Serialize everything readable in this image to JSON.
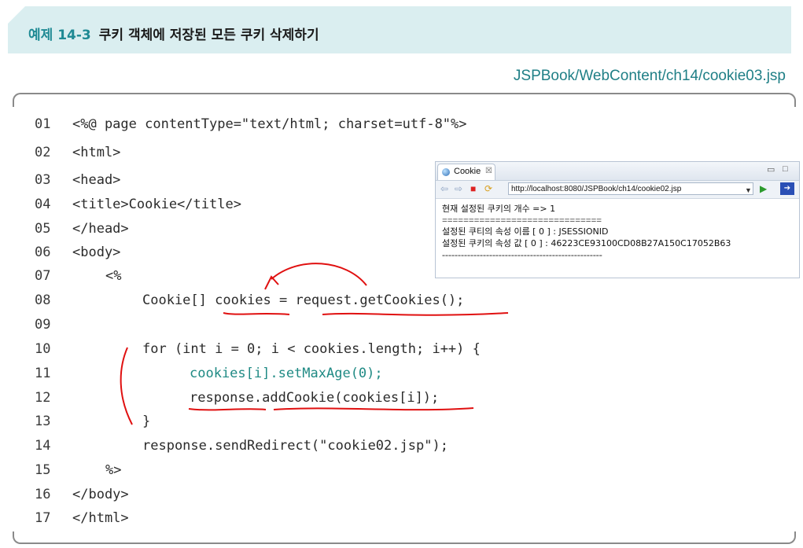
{
  "header": {
    "example_number": "예제 14-3",
    "example_title": "쿠키 객체에 저장된 모든 쿠키 삭제하기"
  },
  "file_path": "JSPBook/WebContent/ch14/cookie03.jsp",
  "code_lines": [
    {
      "num": "01",
      "text": "<%@ page contentType=\"text/html; charset=utf-8\"%>"
    },
    {
      "num": "02",
      "text": "<html>"
    },
    {
      "num": "03",
      "text": "<head>"
    },
    {
      "num": "04",
      "text": "<title>Cookie</title>"
    },
    {
      "num": "05",
      "text": "</head>"
    },
    {
      "num": "06",
      "text": "<body>"
    },
    {
      "num": "07",
      "text": "<%"
    },
    {
      "num": "08",
      "text": "Cookie[] cookies = request.getCookies();"
    },
    {
      "num": "09",
      "text": ""
    },
    {
      "num": "10",
      "text": "for (int i = 0; i < cookies.length; i++) {"
    },
    {
      "num": "11",
      "text": "cookies[i].setMaxAge(0);"
    },
    {
      "num": "12",
      "text": "response.addCookie(cookies[i]);"
    },
    {
      "num": "13",
      "text": "}"
    },
    {
      "num": "14",
      "text": "response.sendRedirect(\"cookie02.jsp\");"
    },
    {
      "num": "15",
      "text": "%>"
    },
    {
      "num": "16",
      "text": "</body>"
    },
    {
      "num": "17",
      "text": "</html>"
    }
  ],
  "browser": {
    "tab_title": "Cookie",
    "tab_close": "☒",
    "url": "http://localhost:8080/JSPBook/ch14/cookie02.jsp",
    "content_lines": [
      "현재 설정된 쿠키의 개수 => 1",
      "==============================",
      "설정된 쿠티의 속성 이름 [ 0 ] : JSESSIONID",
      "설정된 쿠키의 속성 값 [ 0 ] : 46223CE93100CD08B27A150C17052B63",
      "---------------------------------------------------"
    ]
  },
  "colors": {
    "banner_bg": "#daeef0",
    "accent": "#1f8a94",
    "annotation_red": "#e01010",
    "code_green": "#1f8a84"
  }
}
